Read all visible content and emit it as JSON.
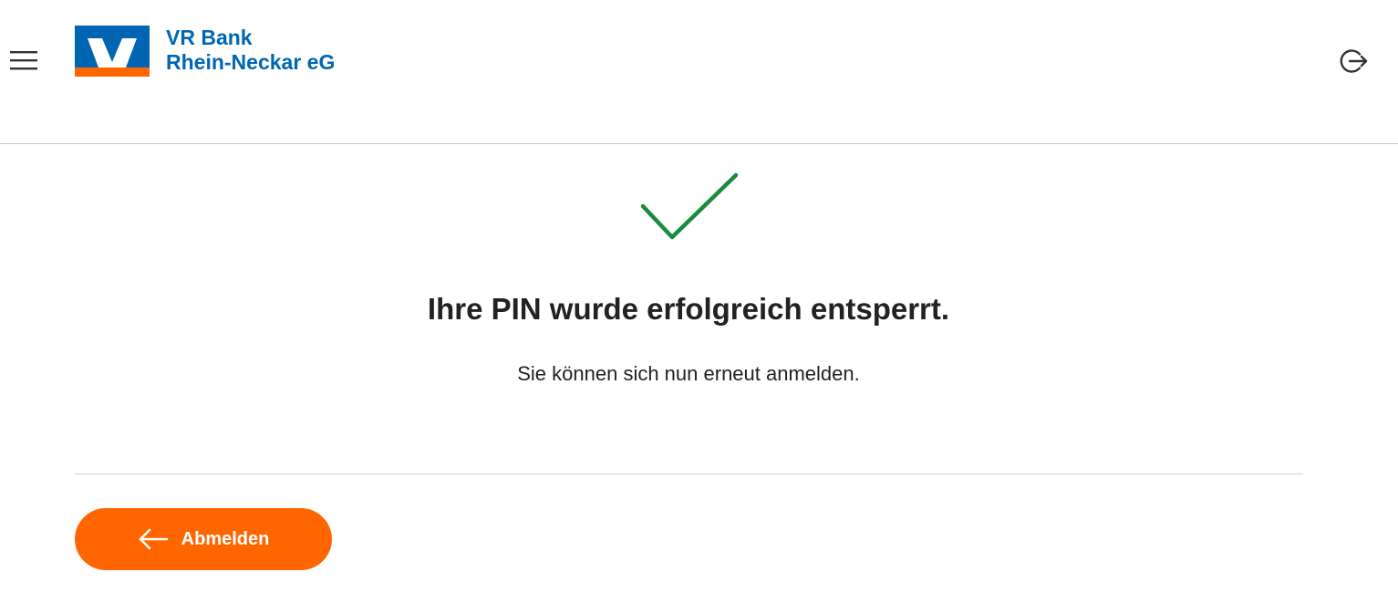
{
  "header": {
    "logo": {
      "line1": "VR Bank",
      "line2": "Rhein-Neckar eG",
      "icon": "volksbank-logo-icon"
    },
    "menu_icon": "hamburger-menu-icon",
    "logout_icon": "logout-icon"
  },
  "main": {
    "status_icon": "checkmark-icon",
    "title": "Ihre PIN wurde erfolgreich entsperrt.",
    "subtitle": "Sie können sich nun erneut anmelden.",
    "logout_button": {
      "label": "Abmelden",
      "icon": "arrow-left-icon"
    }
  },
  "colors": {
    "brand_blue": "#0066b3",
    "brand_orange": "#ff6600",
    "success_green": "#1a8a3c",
    "text": "#222222"
  }
}
